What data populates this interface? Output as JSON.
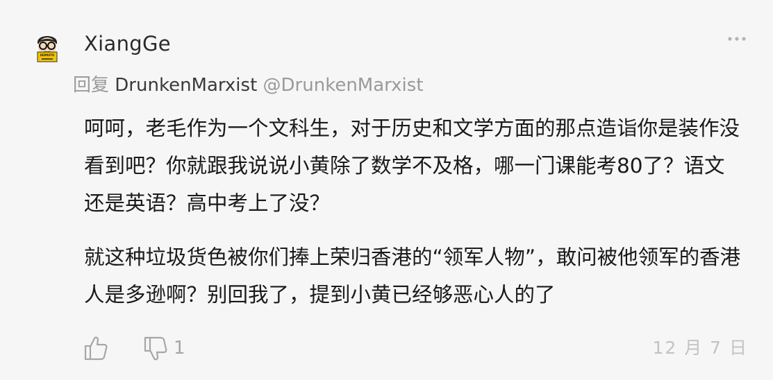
{
  "comment": {
    "author": "XiangGe",
    "reply_prefix": "回复",
    "reply_target": "DrunkenMarxist",
    "reply_handle": "@DrunkenMarxist",
    "paragraphs": [
      "呵呵，老毛作为一个文科生，对于历史和文学方面的那点造诣你是装作没看到吧？你就跟我说说小黄除了数学不及格，哪一门课能考80了？语文还是英语？高中考上了没？",
      "就这种垃圾货色被你们捧上荣归香港的“领军人物”，敢问被他领军的香港人是多逊啊？别回我了，提到小黄已经够恶心人的了"
    ],
    "dislike_count": "1",
    "date": "12 月 7 日",
    "avatar_sign": "DEMISTO"
  },
  "icons": {
    "avatar": "cartoon-avatar-icon",
    "more": "more-dots-icon",
    "like": "thumbs-up-icon",
    "dislike": "thumbs-down-icon"
  },
  "colors": {
    "background": "#f6f6f6",
    "text": "#1a1a1a",
    "muted": "#9a9a9a",
    "icon": "#a6a6a6",
    "date": "#c2c2c2",
    "avatar_sign": "#f2c500"
  }
}
